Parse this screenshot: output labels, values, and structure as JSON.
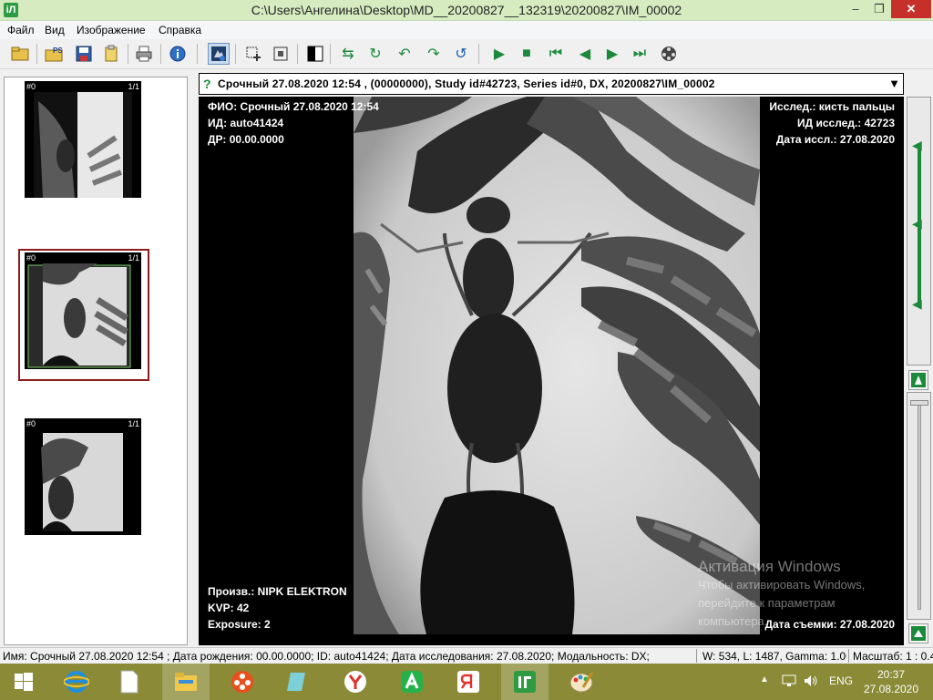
{
  "window": {
    "title": "C:\\Users\\Ангелина\\Desktop\\MD__20200827__132319\\20200827\\IM_00002",
    "app_icon": "iЛ",
    "minimize": "–",
    "maximize": "❐",
    "close": "✕"
  },
  "menu": {
    "items": [
      "Файл",
      "Вид",
      "Изображение",
      "Справка"
    ]
  },
  "toolbar": {
    "icons": [
      "open-folder-icon",
      "export-ps-icon",
      "save-icon",
      "clipboard-icon",
      "print-icon",
      "info-icon",
      "image-info-icon",
      "pan-icon",
      "zoom-fit-icon",
      "invert-icon",
      "flip-icon",
      "rotate-icon",
      "rotate-left-icon",
      "rotate-right-icon",
      "undo-icon",
      "play-icon",
      "stop-icon",
      "first-frame-icon",
      "prev-frame-icon",
      "next-frame-icon",
      "last-frame-icon",
      "cine-icon"
    ],
    "ps_label": "PS"
  },
  "thumbnails": [
    {
      "index": "#0",
      "count": "1/1"
    },
    {
      "index": "#0",
      "count": "1/1"
    },
    {
      "index": "#0",
      "count": "1/1"
    }
  ],
  "series": {
    "marker": "?",
    "selected": "Срочный 27.08.2020 12:54 , (00000000), Study id#42723, Series id#0, DX, 20200827\\IM_00002",
    "arrow": "▼"
  },
  "overlay": {
    "top_left": [
      "ФИО: Срочный 27.08.2020 12:54",
      "ИД: auto41424",
      "ДР: 00.00.0000"
    ],
    "top_right": [
      "Исслед.: кисть пальцы",
      "ИД исслед.: 42723",
      "Дата иссл.: 27.08.2020"
    ],
    "bottom_left": [
      "Произв.: NIPK ELEKTRON",
      "KVP: 42",
      "Exposure: 2"
    ],
    "bottom_right": [
      "Дата съемки: 27.08.2020"
    ]
  },
  "watermark": {
    "line1": "Активация Windows",
    "line2": "Чтобы активировать Windows,",
    "line3": "перейдите к параметрам",
    "line4": "компьютера."
  },
  "statusbar": {
    "info": "Имя: Срочный 27.08.2020 12:54 ; Дата рождения: 00.00.0000; ID: auto41424; Дата исследования: 27.08.2020; Модальность: DX;",
    "window_level": "W: 534, L: 1487, Gamma: 1.00",
    "scale": "Масштаб: 1 : 0.4"
  },
  "taskbar": {
    "apps": [
      "windows-start-icon",
      "internet-explorer-icon",
      "file-icon",
      "file-explorer-icon",
      "media-player-icon",
      "notes-icon",
      "yandex-browser-icon",
      "android-emulator-icon",
      "yandex-icon",
      "dicom-viewer-icon",
      "paint-icon"
    ],
    "lang": "ENG",
    "time": "20:37",
    "date": "27.08.2020"
  },
  "colors": {
    "titlebar": "#d6ecc0",
    "taskbar": "#8a8a37",
    "selected_thumb_border": "#8c1c1c",
    "slider": "#1a8a3a"
  }
}
